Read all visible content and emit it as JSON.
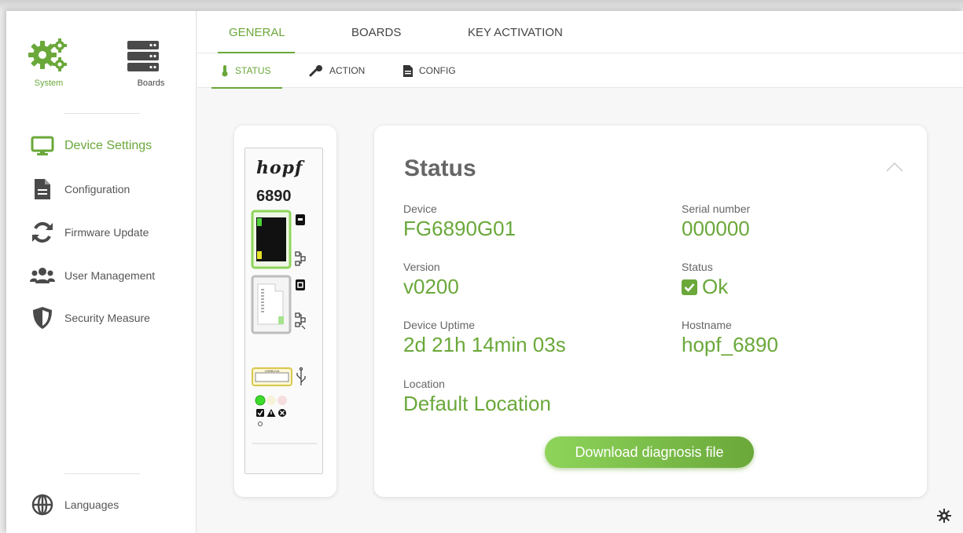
{
  "colors": {
    "accent": "#6aa83a",
    "text": "#555555",
    "background": "#f7f7f7"
  },
  "modules": [
    {
      "label": "System",
      "icon": "gears-icon",
      "active": true
    },
    {
      "label": "Boards",
      "icon": "server-icon",
      "active": false
    }
  ],
  "sidebar": {
    "items": [
      {
        "label": "Device Settings",
        "icon": "monitor-icon",
        "active": true
      },
      {
        "label": "Configuration",
        "icon": "document-icon"
      },
      {
        "label": "Firmware Update",
        "icon": "refresh-icon"
      },
      {
        "label": "User Management",
        "icon": "users-icon"
      },
      {
        "label": "Security Measure",
        "icon": "shield-icon"
      }
    ],
    "languages": {
      "label": "Languages",
      "icon": "globe-icon"
    }
  },
  "tabs": [
    {
      "label": "GENERAL",
      "active": true
    },
    {
      "label": "BOARDS"
    },
    {
      "label": "KEY ACTIVATION"
    }
  ],
  "subtabs": [
    {
      "label": "STATUS",
      "icon": "thermometer-icon",
      "active": true
    },
    {
      "label": "ACTION",
      "icon": "wrench-icon"
    },
    {
      "label": "CONFIG",
      "icon": "file-icon"
    }
  ],
  "device_panel": {
    "brand": "hopf",
    "model": "6890",
    "usb_label": "USBBUVA",
    "leds": [
      "green",
      "off",
      "off"
    ],
    "led_icons": [
      "check-icon",
      "warning-icon",
      "error-icon"
    ]
  },
  "status": {
    "title": "Status",
    "fields": [
      {
        "label": "Device",
        "value": "FG6890G01"
      },
      {
        "label": "Serial number",
        "value": "000000"
      },
      {
        "label": "Version",
        "value": "v0200"
      },
      {
        "label": "Status",
        "value": "Ok",
        "checked": true
      },
      {
        "label": "Device Uptime",
        "value": "2d 21h 14min 03s"
      },
      {
        "label": "Hostname",
        "value": "hopf_6890"
      },
      {
        "label": "Location",
        "value": "Default Location"
      }
    ],
    "download_label": "Download diagnosis file"
  }
}
